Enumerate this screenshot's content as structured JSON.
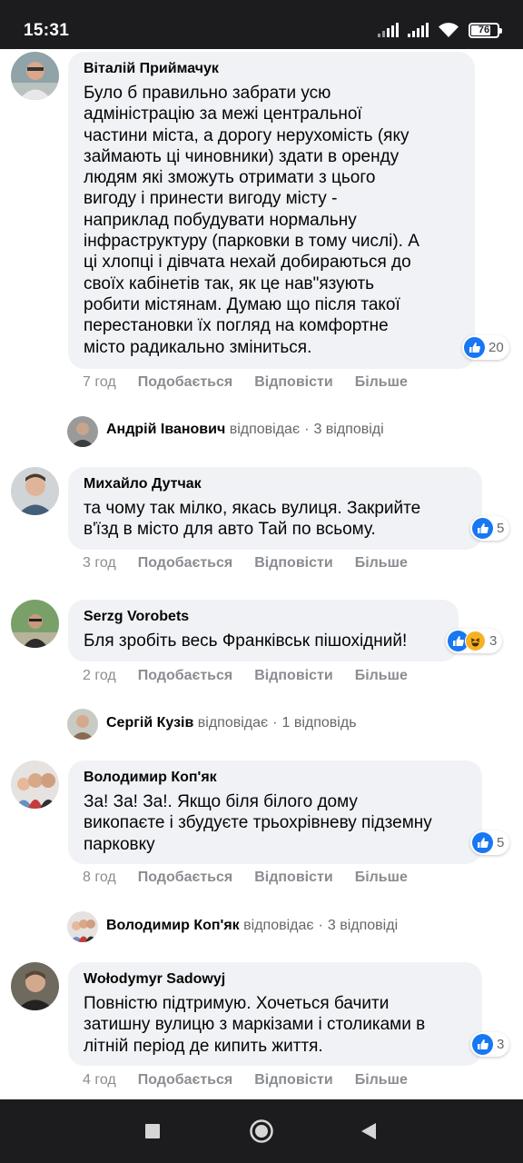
{
  "status_bar": {
    "time": "15:31",
    "battery": "76",
    "battery_fraction": 0.76,
    "icons": [
      "signal-icon",
      "signal-icon",
      "wifi-icon",
      "battery-icon"
    ]
  },
  "actions": {
    "like": "Подобається",
    "reply": "Відповісти",
    "more": "Більше"
  },
  "comments": [
    {
      "author": "Віталій Приймачук",
      "text": "Було б правильно забрати усю\nадміністрацію за межі центральної\nчастини міста, а дорогу нерухомість (яку\nзаймають ці чиновники) здати в оренду\nлюдям які зможуть отримати з цього\nвигоду і принести вигоду місту -\nнаприклад побудувати нормальну\nінфраструктуру (парковки в тому числі). А\nці хлопці і дівчата нехай добираються до\nсвоїх кабінетів так, як це нав\"язують\nробити містянам. Думаю що після такої\nперестановки їх погляд на комфортне\nмісто радикально зміниться.",
      "reactions": "20",
      "time": "7 год"
    },
    {
      "author": "Михайло Дутчак",
      "text": "та чому так мілко, якась вулиця. Закрийте\nв'їзд в місто для авто Тай по всьому.",
      "reactions": "5",
      "time": "3 год"
    },
    {
      "author": "Serzg Vorobets",
      "text": "Бля зробіть весь Франківськ пішохідний!",
      "reactions": "3",
      "time": "2 год"
    },
    {
      "author": "Володимир Коп'як",
      "text": "За! За! За!. Якщо біля білого дому\nвикопаєте і збудуєте трьохрівневу підземну\nпарковку",
      "reactions": "5",
      "time": "8 год"
    },
    {
      "author": "Wołodymyr Sadowyj",
      "text": "Повністю підтримую. Хочеться бачити\nзатишну вулицю з маркізами і столиками в\nлітній період де кипить життя.",
      "reactions": "3",
      "time": "4 год"
    }
  ],
  "replies": [
    {
      "name": "Андрій Іванович",
      "verb": "відповідає",
      "sep": "·",
      "count": "3 відповіді"
    },
    {
      "name": "Сергій Кузів",
      "verb": "відповідає",
      "sep": "·",
      "count": "1 відповідь"
    },
    {
      "name": "Володимир Коп'як",
      "verb": "відповідає",
      "sep": "·",
      "count": "3 відповіді"
    }
  ],
  "colors": {
    "like_blue": "#1877f2",
    "bubble_bg": "#f0f2f5",
    "meta_gray": "#8a8d91",
    "system_bar": "#1c1c1e"
  },
  "nav_bar": {
    "icons": [
      "recent-apps-icon",
      "home-icon",
      "back-icon"
    ]
  }
}
